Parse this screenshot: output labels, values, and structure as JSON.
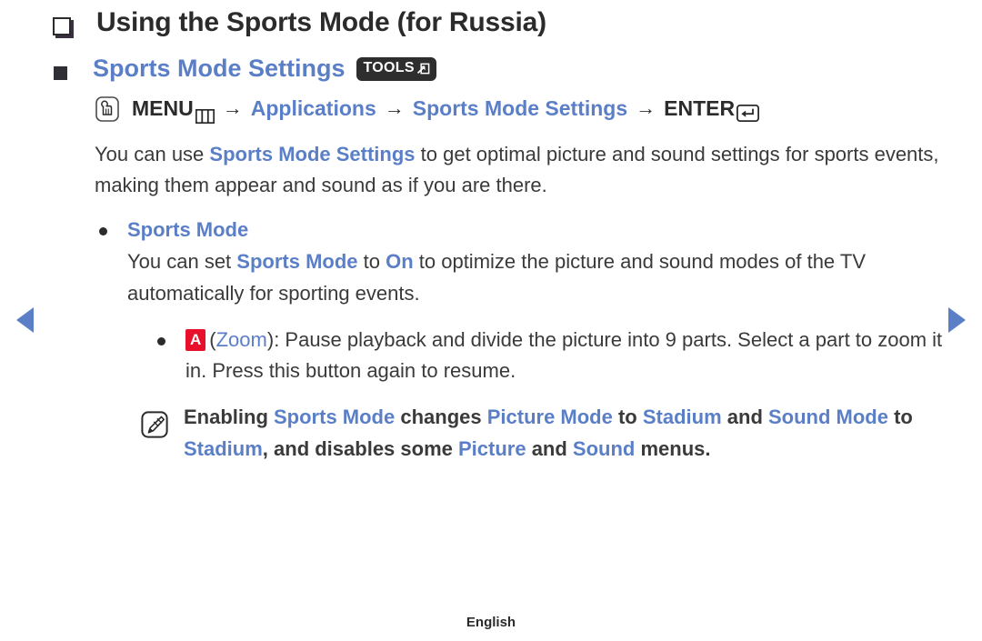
{
  "nav": {
    "prev_label": "Previous page",
    "next_label": "Next page"
  },
  "heading": {
    "title": "Using the Sports Mode (for Russia)",
    "subtitle": "Sports Mode Settings",
    "tools_badge": "TOOLS"
  },
  "menu_path": {
    "press_icon": "press-button-icon",
    "menu_label": "MENU",
    "grid_icon": "menu-grid-icon",
    "arrow": "→",
    "item1": "Applications",
    "item2": "Sports Mode Settings",
    "enter_label": "ENTER",
    "enter_icon": "enter-key-icon"
  },
  "intro": {
    "text_1": "You can use ",
    "highlight_1": "Sports Mode Settings",
    "text_2": " to get optimal picture and sound settings for sports events, making them appear and sound as if you are there."
  },
  "bullets": [
    {
      "title": "Sports Mode",
      "body_1": "You can set ",
      "highlight_1": "Sports Mode",
      "body_2": " to ",
      "highlight_2": "On",
      "body_3": " to optimize the picture and sound modes of the TV automatically for sporting events."
    }
  ],
  "zoom_bullet": {
    "key_badge": "A",
    "open_paren": "(",
    "highlight": "Zoom",
    "close_paren": ")",
    "body": ": Pause playback and divide the picture into 9 parts. Select a part to zoom it in. Press this button again to resume."
  },
  "note": {
    "icon": "note-pencil-icon",
    "text_1": "Enabling ",
    "highlight_1": "Sports Mode",
    "text_2": " changes ",
    "highlight_2": "Picture Mode",
    "text_3": " to ",
    "highlight_3": "Stadium",
    "text_4": " and ",
    "highlight_4": "Sound Mode",
    "text_5": " to ",
    "highlight_5": "Stadium",
    "text_6": ", and disables some ",
    "highlight_6": "Picture",
    "text_7": " and ",
    "highlight_7": "Sound",
    "text_8": " menus."
  },
  "footer": {
    "language": "English"
  },
  "colors": {
    "accent_blue": "#5b7fc7",
    "text_dark": "#2b2b2b",
    "key_red": "#e8102a",
    "badge_dark": "#2e2e2e",
    "background": "#ffffff"
  }
}
